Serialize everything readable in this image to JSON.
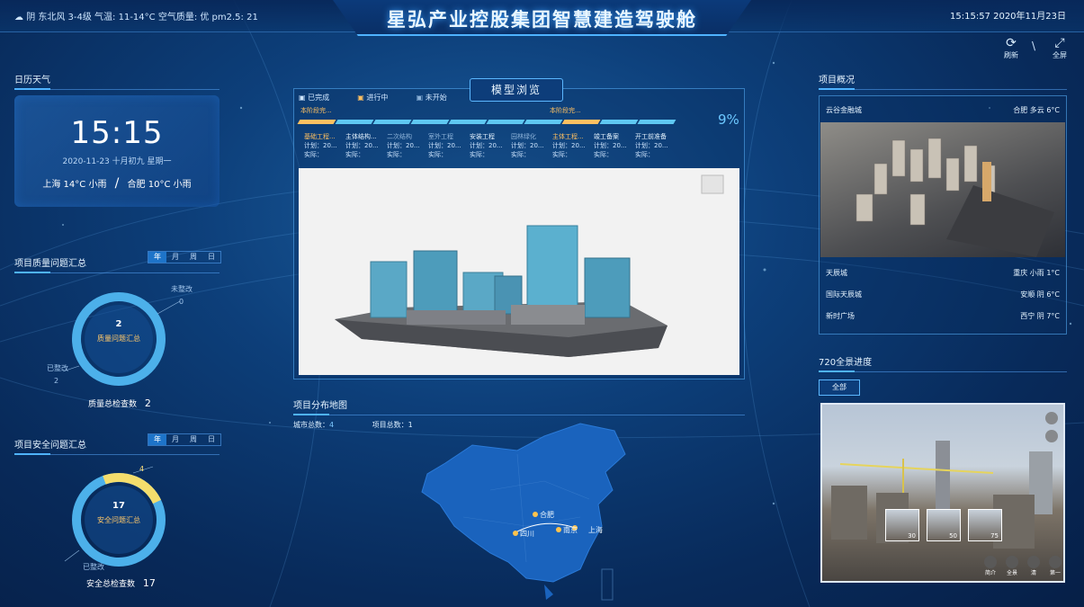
{
  "header": {
    "title": "星弘产业控股集团智慧建造驾驶舱",
    "weather": "阴  东北风 3-4级  气温: 11-14°C  空气质量: 优  pm2.5: 21",
    "datetime": "15:15:57  2020年11月23日",
    "refresh_label": "刷新",
    "fullscreen_label": "全屏",
    "separator": "\\"
  },
  "calendar": {
    "section_title": "日历天气",
    "time": "15:15",
    "date": "2020-11-23   十月初九  星期一",
    "city1": "上海 14°C 小雨",
    "city2": "合肥 10°C 小雨"
  },
  "quality": {
    "section_title": "项目质量问题汇总",
    "tabs": [
      "年",
      "月",
      "周",
      "日"
    ],
    "center_value": "2",
    "center_label": "质量问题汇总",
    "top_label": "未整改",
    "top_value": "0",
    "bottom_label": "已整改",
    "bottom_value": "2",
    "total_label": "质量总检查数",
    "total_value": "2",
    "ring_fraction": 1.0
  },
  "safety": {
    "section_title": "项目安全问题汇总",
    "tabs": [
      "年",
      "月",
      "周",
      "日"
    ],
    "center_value": "17",
    "center_label": "安全问题汇总",
    "top_value": "4",
    "bottom_label": "已整改",
    "total_label": "安全总检查数",
    "total_value": "17",
    "unresolved_fraction": 0.235
  },
  "model": {
    "title": "模型浏览",
    "legend": [
      "已完成",
      "进行中",
      "未开始"
    ],
    "percent": "9%",
    "current_tag": "本阶段完...",
    "current_tag2": "本阶段完...",
    "stages": [
      {
        "name": "基础工程...",
        "plan": "计划：20...",
        "actual": "实际：",
        "state": "cur"
      },
      {
        "name": "主体结构...",
        "plan": "计划：20...",
        "actual": "实际：",
        "state": "done"
      },
      {
        "name": "二次结构",
        "plan": "计划：20...",
        "actual": "实际：",
        "state": "dim"
      },
      {
        "name": "室外工程",
        "plan": "计划：20...",
        "actual": "实际：",
        "state": "dim"
      },
      {
        "name": "安装工程",
        "plan": "计划：20...",
        "actual": "实际：",
        "state": "done"
      },
      {
        "name": "园林绿化",
        "plan": "计划：20...",
        "actual": "实际：",
        "state": "dim"
      },
      {
        "name": "主体工程...",
        "plan": "计划：20...",
        "actual": "实际：",
        "state": "cur"
      },
      {
        "name": "竣工备案",
        "plan": "计划：20...",
        "actual": "实际：",
        "state": "done"
      },
      {
        "name": "开工前准备",
        "plan": "计划：20...",
        "actual": "实际：",
        "state": "done"
      }
    ]
  },
  "map": {
    "section_title": "项目分布地图",
    "city_count_label": "城市总数：",
    "city_count": "4",
    "project_count_label": "项目总数：",
    "project_count": "1",
    "cities": [
      "合肥",
      "四川",
      "南京",
      "上海"
    ]
  },
  "overview": {
    "section_title": "项目概况",
    "featured_name": "云谷金融城",
    "featured_weather": "合肥 多云 6°C",
    "items": [
      {
        "name": "天辰城",
        "weather": "重庆 小雨 1°C"
      },
      {
        "name": "国际天辰城",
        "weather": "安顺 阴 6°C"
      },
      {
        "name": "新时广场",
        "weather": "西宁 阴 7°C"
      }
    ]
  },
  "panorama": {
    "section_title": "720全景进度",
    "button_label": "全部",
    "thumbs": [
      "30",
      "50",
      "75"
    ],
    "controls": [
      "简介",
      "全景",
      "清",
      "第一"
    ]
  }
}
